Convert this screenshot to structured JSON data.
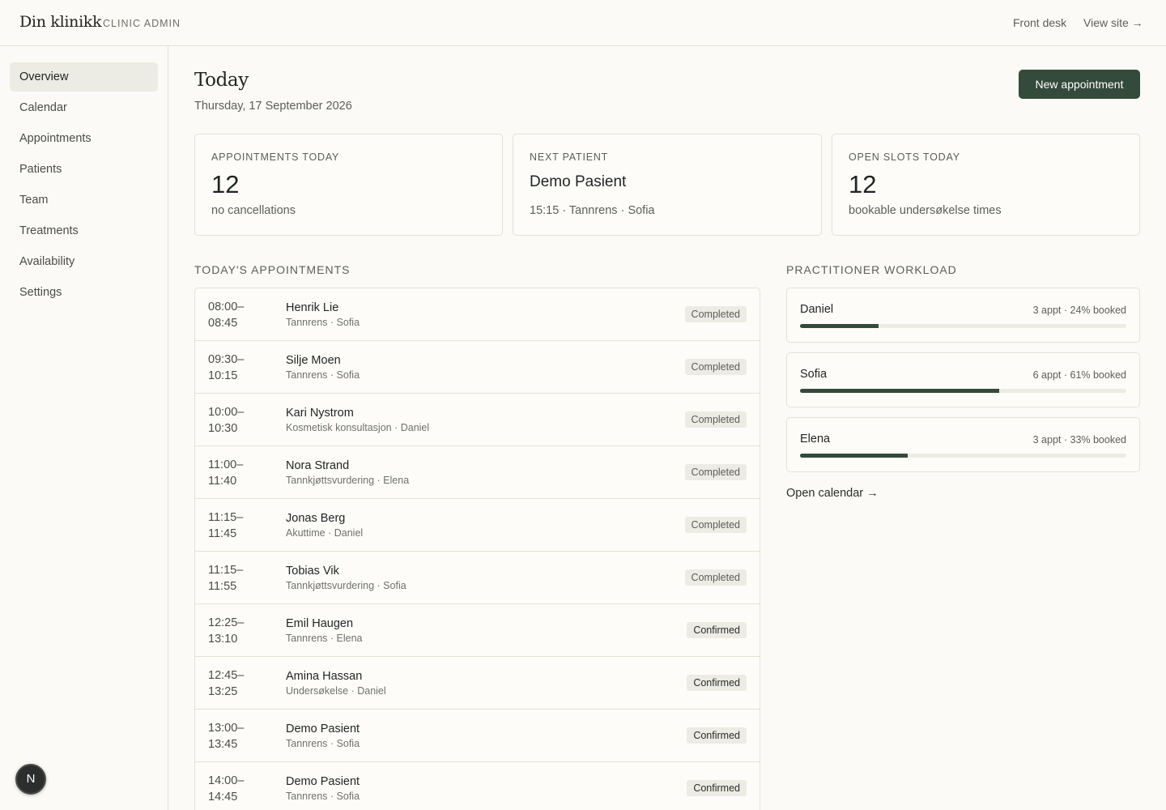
{
  "header": {
    "brand": "Din klinikk",
    "brand_sub": "CLINIC ADMIN",
    "front_desk": "Front desk",
    "view_site": "View site →"
  },
  "sidebar": {
    "items": [
      {
        "label": "Overview",
        "active": true
      },
      {
        "label": "Calendar"
      },
      {
        "label": "Appointments"
      },
      {
        "label": "Patients"
      },
      {
        "label": "Team"
      },
      {
        "label": "Treatments"
      },
      {
        "label": "Availability"
      },
      {
        "label": "Settings"
      }
    ],
    "badge": "N"
  },
  "page": {
    "title": "Today",
    "date": "Thursday, 17 September 2026",
    "new_button": "New appointment"
  },
  "stats": {
    "appointments": {
      "label": "APPOINTMENTS TODAY",
      "value": "12",
      "sub": "no cancellations"
    },
    "next_patient": {
      "label": "NEXT PATIENT",
      "name": "Demo Pasient",
      "sub": "15:15 · Tannrens · Sofia"
    },
    "open_slots": {
      "label": "OPEN SLOTS TODAY",
      "value": "12",
      "sub": "bookable undersøkelse times"
    }
  },
  "appointments": {
    "title": "TODAY'S APPOINTMENTS",
    "rows": [
      {
        "start": "08:00–",
        "end": "08:45",
        "name": "Henrik Lie",
        "meta": "Tannrens · Sofia",
        "status": "Completed"
      },
      {
        "start": "09:30–",
        "end": "10:15",
        "name": "Silje Moen",
        "meta": "Tannrens · Sofia",
        "status": "Completed"
      },
      {
        "start": "10:00–",
        "end": "10:30",
        "name": "Kari Nystrom",
        "meta": "Kosmetisk konsultasjon · Daniel",
        "status": "Completed"
      },
      {
        "start": "11:00–",
        "end": "11:40",
        "name": "Nora Strand",
        "meta": "Tannkjøttsvurdering · Elena",
        "status": "Completed"
      },
      {
        "start": "11:15–",
        "end": "11:45",
        "name": "Jonas Berg",
        "meta": "Akuttime · Daniel",
        "status": "Completed"
      },
      {
        "start": "11:15–",
        "end": "11:55",
        "name": "Tobias Vik",
        "meta": "Tannkjøttsvurdering · Sofia",
        "status": "Completed"
      },
      {
        "start": "12:25–",
        "end": "13:10",
        "name": "Emil Haugen",
        "meta": "Tannrens · Elena",
        "status": "Confirmed"
      },
      {
        "start": "12:45–",
        "end": "13:25",
        "name": "Amina Hassan",
        "meta": "Undersøkelse · Daniel",
        "status": "Confirmed"
      },
      {
        "start": "13:00–",
        "end": "13:45",
        "name": "Demo Pasient",
        "meta": "Tannrens · Sofia",
        "status": "Confirmed"
      },
      {
        "start": "14:00–",
        "end": "14:45",
        "name": "Demo Pasient",
        "meta": "Tannrens · Sofia",
        "status": "Confirmed"
      }
    ]
  },
  "workload": {
    "title": "PRACTITIONER WORKLOAD",
    "items": [
      {
        "name": "Daniel",
        "stat": "3 appt · 24% booked",
        "booked_pct": 24
      },
      {
        "name": "Sofia",
        "stat": "6 appt · 61% booked",
        "booked_pct": 61
      },
      {
        "name": "Elena",
        "stat": "3 appt · 33% booked",
        "booked_pct": 33
      }
    ],
    "open_calendar": "Open calendar →"
  },
  "colors": {
    "accent": "#344a3b",
    "background": "#fbfaf6",
    "border": "#e4e1d8"
  }
}
